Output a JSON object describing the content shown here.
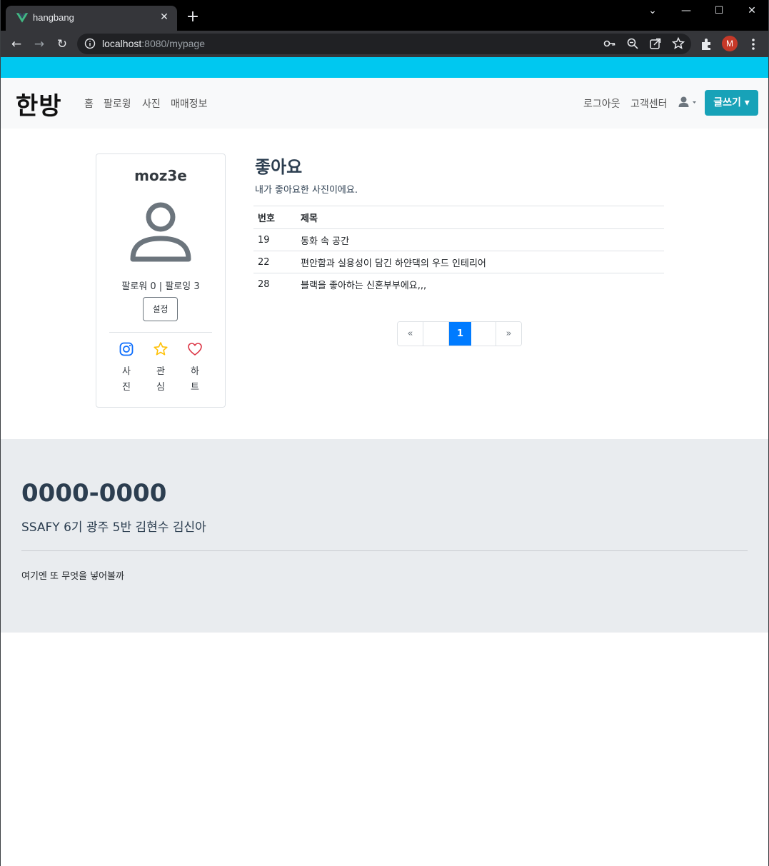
{
  "browser": {
    "tab_title": "hangbang",
    "tab_close": "✕",
    "new_tab": "+",
    "url_host": "localhost",
    "url_path": ":8080/mypage",
    "profile_initial": "M",
    "window_controls": {
      "minimize": "—",
      "maximize": "☐",
      "close": "✕",
      "dropdown": "⌄"
    }
  },
  "navbar": {
    "brand": "한방",
    "links": [
      "홈",
      "팔로윙",
      "사진",
      "매매정보"
    ],
    "right_links": [
      "로그아웃",
      "고객센터"
    ],
    "write_button": "글쓰기 ▾"
  },
  "profile": {
    "username": "moz3e",
    "follow_info": "팔로워 0 | 팔로잉 3",
    "settings_button": "설정",
    "tabs": [
      {
        "label": "사진",
        "icon": "instagram-icon",
        "color": "#0d6efd"
      },
      {
        "label": "관심",
        "icon": "star-icon",
        "color": "#ffc107"
      },
      {
        "label": "하트",
        "icon": "heart-icon",
        "color": "#dc3545"
      }
    ]
  },
  "likes": {
    "title": "좋아요",
    "description": "내가 좋아요한 사진이에요.",
    "columns": [
      "번호",
      "제목"
    ],
    "rows": [
      {
        "num": "19",
        "title": "동화 속 공간"
      },
      {
        "num": "22",
        "title": "편안함과 실용성이 담긴 하얀댁의 우드 인테리어"
      },
      {
        "num": "28",
        "title": "블랙을 좋아하는 신혼부부에요,,,"
      }
    ]
  },
  "pagination": {
    "first": "«",
    "current": "1",
    "last": "»",
    "active_color": "#007bff"
  },
  "footer": {
    "phone": "0000-0000",
    "team": "SSAFY 6기 광주 5반 김현수 김신아",
    "extra": "여기엔 또 무엇을 넣어볼까"
  },
  "colors": {
    "accent_strip": "#00c8f0",
    "write_button": "#17a2b8",
    "footer_bg": "#e9ecef"
  }
}
